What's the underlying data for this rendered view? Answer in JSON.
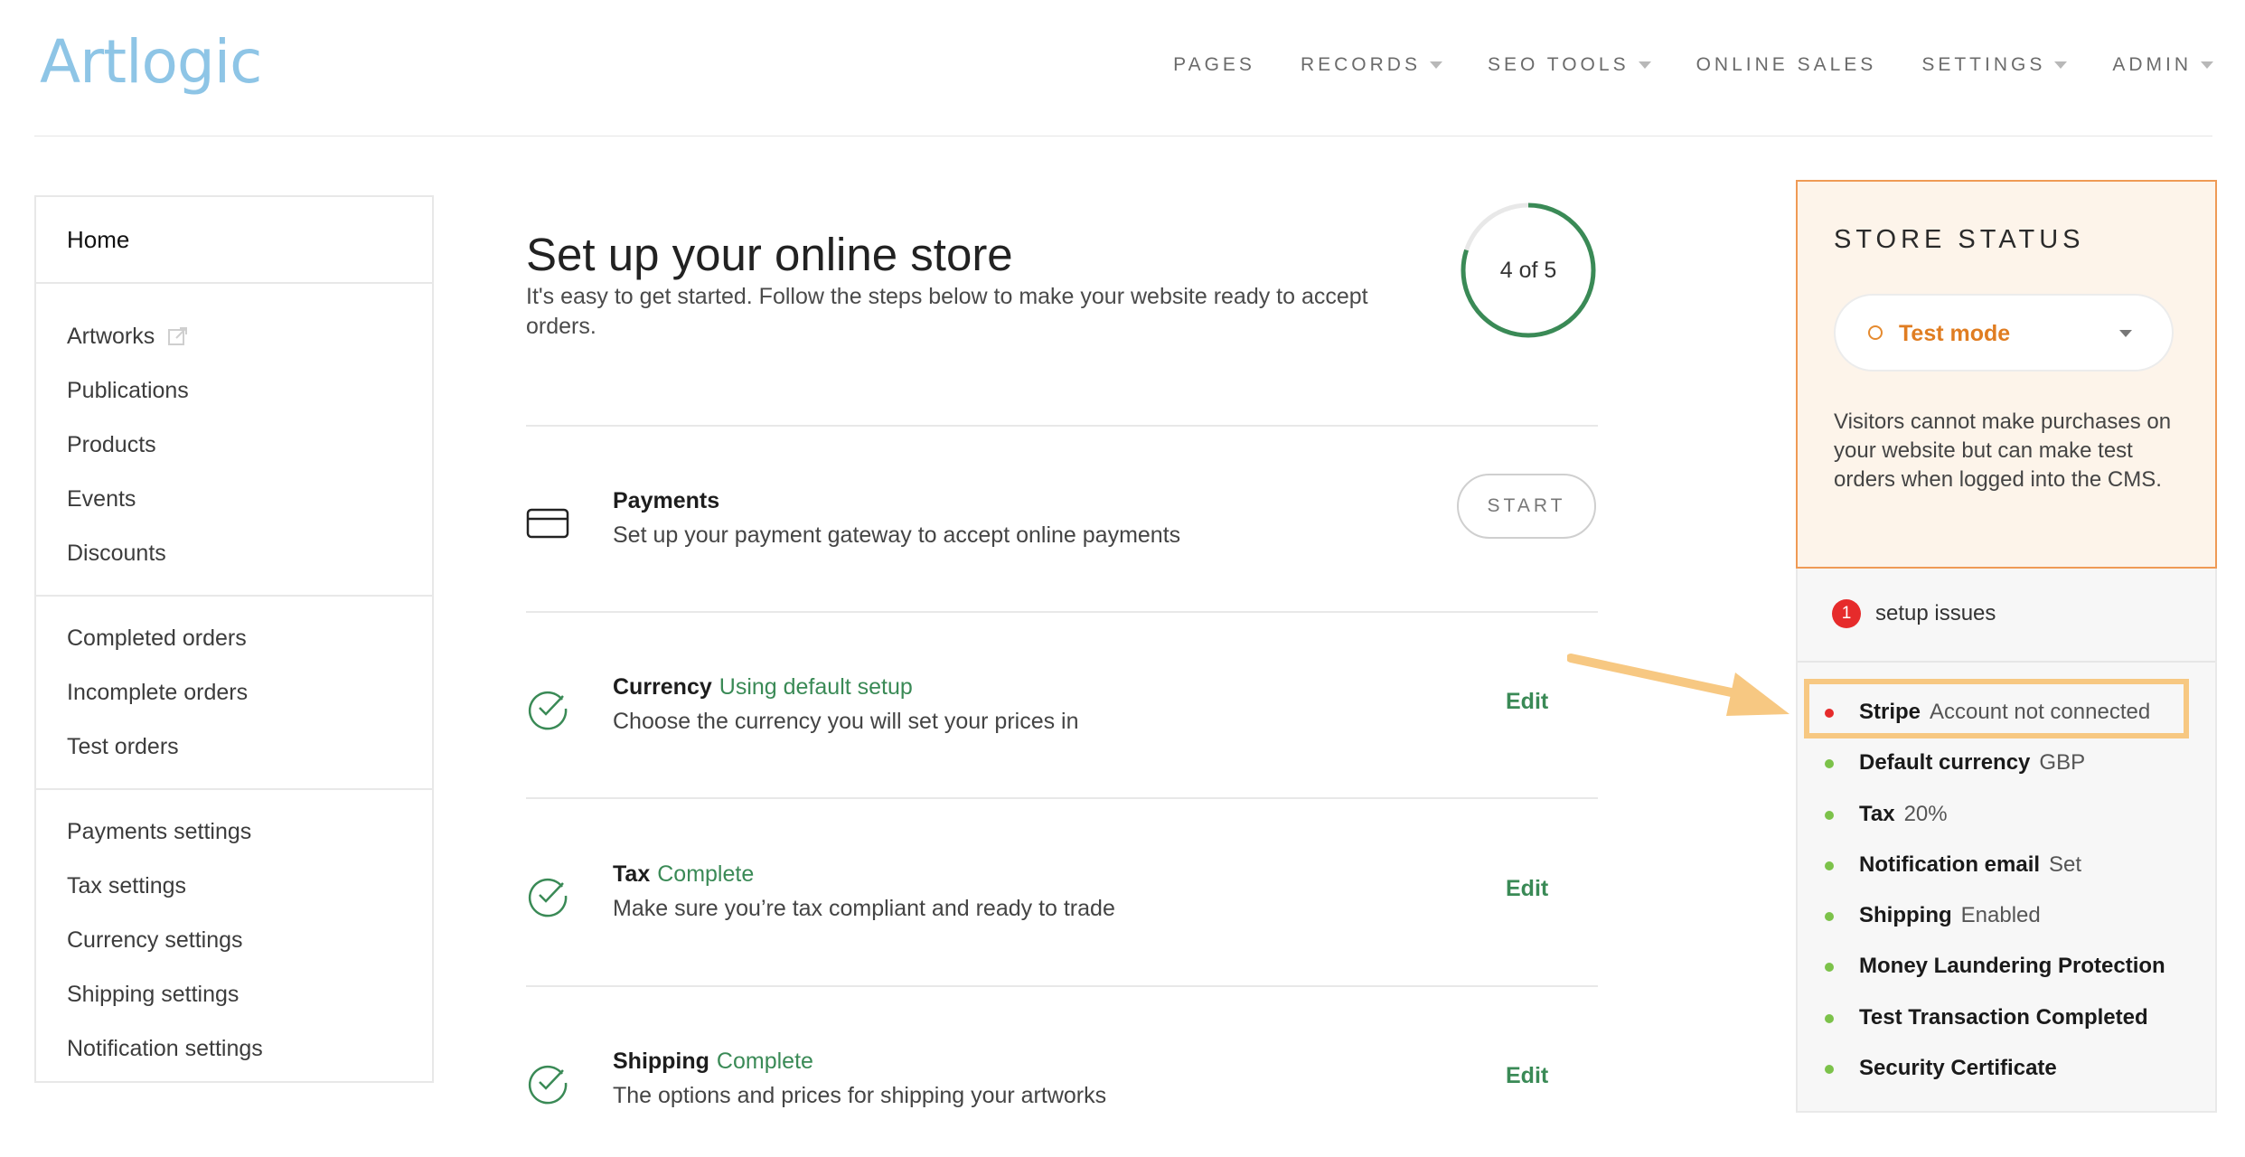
{
  "app": {
    "logo": "Artlogic"
  },
  "topnav": [
    {
      "label": "PAGES",
      "dropdown": false
    },
    {
      "label": "RECORDS",
      "dropdown": true
    },
    {
      "label": "SEO TOOLS",
      "dropdown": true
    },
    {
      "label": "ONLINE SALES",
      "dropdown": false
    },
    {
      "label": "SETTINGS",
      "dropdown": true
    },
    {
      "label": "ADMIN",
      "dropdown": true
    }
  ],
  "sidebar": {
    "home": "Home",
    "group1": [
      "Artworks",
      "Publications",
      "Products",
      "Events",
      "Discounts"
    ],
    "group2": [
      "Completed orders",
      "Incomplete orders",
      "Test orders"
    ],
    "group3": [
      "Payments settings",
      "Tax settings",
      "Currency settings",
      "Shipping settings",
      "Notification settings"
    ]
  },
  "main": {
    "title": "Set up your online store",
    "subtitle": "It's easy to get started. Follow the steps below to make your website ready to accept orders.",
    "progress": {
      "label": "4 of 5",
      "completed": 4,
      "total": 5
    },
    "steps": [
      {
        "title": "Payments",
        "status": "",
        "desc": "Set up your payment gateway to accept online payments",
        "action": "START",
        "icon": "credit-card-icon"
      },
      {
        "title": "Currency",
        "status": "Using default setup",
        "desc": "Choose the currency you will set your prices in",
        "action": "Edit",
        "icon": "check-circle-icon"
      },
      {
        "title": "Tax",
        "status": "Complete",
        "desc": "Make sure you’re tax compliant and ready to trade",
        "action": "Edit",
        "icon": "check-circle-icon"
      },
      {
        "title": "Shipping",
        "status": "Complete",
        "desc": "The options and prices for shipping your artworks",
        "action": "Edit",
        "icon": "check-circle-icon"
      }
    ]
  },
  "store_status": {
    "heading": "STORE STATUS",
    "mode": "Test mode",
    "description": "Visitors cannot make purchases on your website but can make test orders when logged into the CMS.",
    "issues_count": "1",
    "issues_label": "setup issues",
    "checks": [
      {
        "name": "Stripe",
        "value": "Account not connected",
        "status_color": "#e62b2b"
      },
      {
        "name": "Default currency",
        "value": "GBP",
        "status_color": "#7cc24a"
      },
      {
        "name": "Tax",
        "value": "20%",
        "status_color": "#7cc24a"
      },
      {
        "name": "Notification email",
        "value": "Set",
        "status_color": "#7cc24a"
      },
      {
        "name": "Shipping",
        "value": "Enabled",
        "status_color": "#7cc24a"
      },
      {
        "name": "Money Laundering Protection",
        "value": "",
        "status_color": "#7cc24a"
      },
      {
        "name": "Test Transaction Completed",
        "value": "",
        "status_color": "#7cc24a"
      },
      {
        "name": "Security Certificate",
        "value": "",
        "status_color": "#7cc24a"
      }
    ]
  },
  "colors": {
    "brand": "#8ec5e6",
    "success": "#3a8a56",
    "warning": "#e07d22",
    "error": "#e62b2b",
    "ok_dot": "#7cc24a",
    "highlight": "#f7c882"
  }
}
